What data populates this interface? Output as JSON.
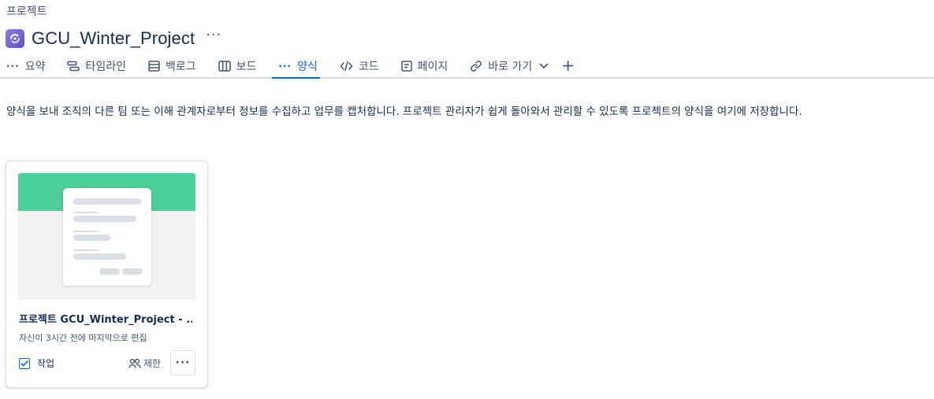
{
  "breadcrumb": "프로젝트",
  "project": {
    "title": "GCU_Winter_Project",
    "more_label": "···"
  },
  "tabs": [
    {
      "label": "요약",
      "icon": "dots-icon",
      "active": false
    },
    {
      "label": "타임라인",
      "icon": "timeline-icon",
      "active": false
    },
    {
      "label": "백로그",
      "icon": "backlog-icon",
      "active": false
    },
    {
      "label": "보드",
      "icon": "board-icon",
      "active": false
    },
    {
      "label": "양식",
      "icon": "dots-icon",
      "active": true
    },
    {
      "label": "코드",
      "icon": "code-icon",
      "active": false
    },
    {
      "label": "페이지",
      "icon": "page-icon",
      "active": false
    },
    {
      "label": "바로 가기",
      "icon": "link-icon",
      "active": false
    }
  ],
  "tab_add_label": "+",
  "description": "양식을 보내 조직의 다른 팀 또는 이해 관계자로부터 정보를 수집하고 업무를 캡처합니다. 프로젝트 관리자가 쉽게 돌아와서 관리할 수 있도록 프로젝트의 양식을 여기에 저장합니다.",
  "form_card": {
    "title": "프로젝트 GCU_Winter_Project - ...",
    "subtitle": "자신이 3시간 전에 마지막으로 편집",
    "work_type": "작업",
    "access": "제한",
    "more_label": "···"
  },
  "colors": {
    "accent": "#0c66e4",
    "thumbnail_band": "#4bce97",
    "project_icon": "#6e5dc6"
  }
}
